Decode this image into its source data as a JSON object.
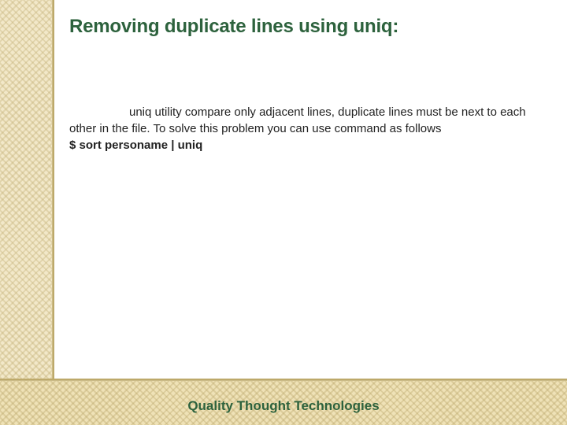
{
  "slide": {
    "title": "Removing duplicate lines using uniq:",
    "body_text": "uniq utility compare only adjacent lines, duplicate lines must be next to each other in the file. To solve this problem you can use command as follows",
    "command": "$ sort personame | uniq",
    "footer": "Quality Thought Technologies"
  },
  "theme": {
    "accent": "#2d623d",
    "strip_bg": "#f2e8c9",
    "bottom_bg": "#efe2b7"
  }
}
